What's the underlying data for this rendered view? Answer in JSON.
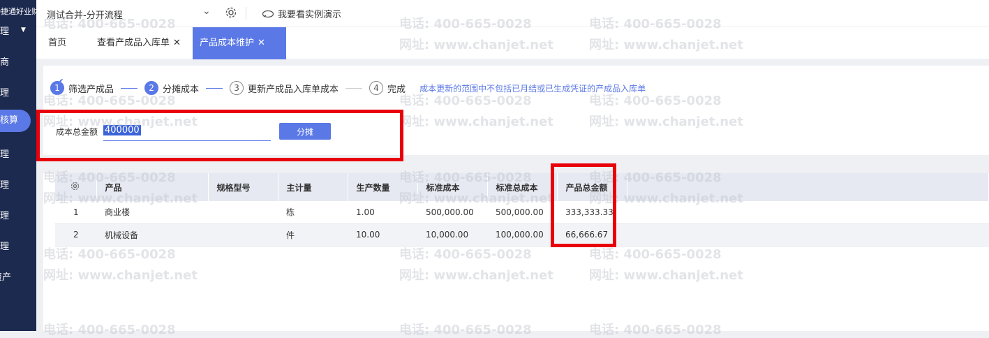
{
  "sidebar": {
    "brand": "畅捷通好业财",
    "items": [
      "理",
      "商",
      "理",
      "核算",
      "理",
      "理",
      "理",
      "理",
      "资产"
    ]
  },
  "topbar": {
    "account_name": "测试合并-分开流程",
    "demo_label": "我要看实例演示"
  },
  "tabs": [
    "首页",
    "查看产成品入库单",
    "产品成本维护"
  ],
  "steps": [
    {
      "num": "1",
      "label": "筛选产成品"
    },
    {
      "num": "2",
      "label": "分摊成本"
    },
    {
      "num": "3",
      "label": "更新产成品入库单成本"
    },
    {
      "num": "4",
      "label": "完成"
    }
  ],
  "step_note": "成本更新的范围中不包括已月结或已生成凭证的产成品入库单",
  "cost": {
    "label": "成本总金额",
    "value": "400000",
    "button": "分摊"
  },
  "table": {
    "columns": [
      "产品",
      "规格型号",
      "主计量",
      "生产数量",
      "标准成本",
      "标准总成本",
      "产品总金额"
    ],
    "rows": [
      [
        "1",
        "商业楼",
        "",
        "栋",
        "1.00",
        "500,000.00",
        "500,000.00",
        "333,333.33"
      ],
      [
        "2",
        "机械设备",
        "",
        "件",
        "10.00",
        "10,000.00",
        "100,000.00",
        "66,666.67"
      ]
    ]
  },
  "watermark": {
    "phone": "电话: 400-665-0028",
    "site": "网址: www.chanjet.net"
  },
  "colors": {
    "accent": "#5a78e6",
    "sidebar": "#1d2a4f",
    "highlight": "#e8000b"
  }
}
